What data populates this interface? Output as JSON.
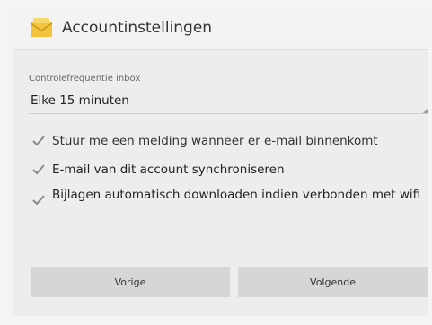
{
  "header": {
    "title": "Accountinstellingen",
    "icon": "email-app-icon"
  },
  "settings": {
    "frequency_label": "Controlefrequentie inbox",
    "frequency_value": "Elke 15 minuten",
    "checkboxes": [
      {
        "label": "Stuur me een melding wanneer er e-mail binnenkomt",
        "checked": true
      },
      {
        "label": "E-mail van dit account synchroniseren",
        "checked": true
      },
      {
        "label": "Bijlagen automatisch downloaden indien verbonden met wifi",
        "checked": true
      }
    ]
  },
  "footer": {
    "prev_label": "Vorige",
    "next_label": "Volgende"
  },
  "colors": {
    "icon_yellow": "#f2c33b",
    "button_bg": "#d6d6d6",
    "checkmark": "#8a8a8a"
  }
}
